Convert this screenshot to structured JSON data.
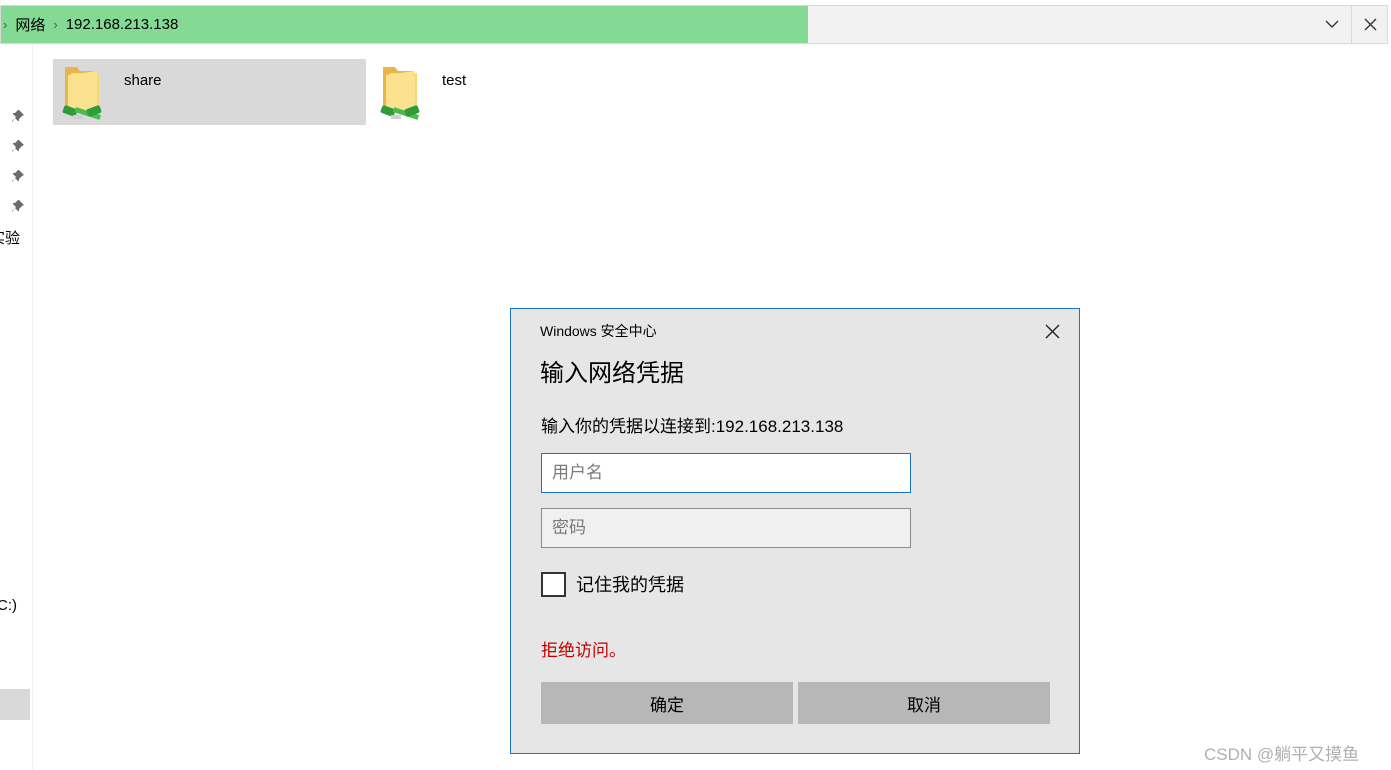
{
  "address_bar": {
    "segments": [
      "网络",
      "192.168.213.138"
    ]
  },
  "nav": {
    "items": [
      "实验",
      "(C:)"
    ]
  },
  "content": {
    "items": [
      {
        "name": "share",
        "selected": true
      },
      {
        "name": "test",
        "selected": false
      }
    ]
  },
  "dialog": {
    "title": "Windows 安全中心",
    "heading": "输入网络凭据",
    "message": "输入你的凭据以连接到:192.168.213.138",
    "username_placeholder": "用户名",
    "password_placeholder": "密码",
    "remember_label": "记住我的凭据",
    "error": "拒绝访问。",
    "ok_label": "确定",
    "cancel_label": "取消"
  },
  "watermark": "CSDN @躺平又摸鱼",
  "colors": {
    "progress": "#84d994",
    "accent": "#1c74c4",
    "error": "#c00000",
    "button": "#b7b7b7"
  }
}
